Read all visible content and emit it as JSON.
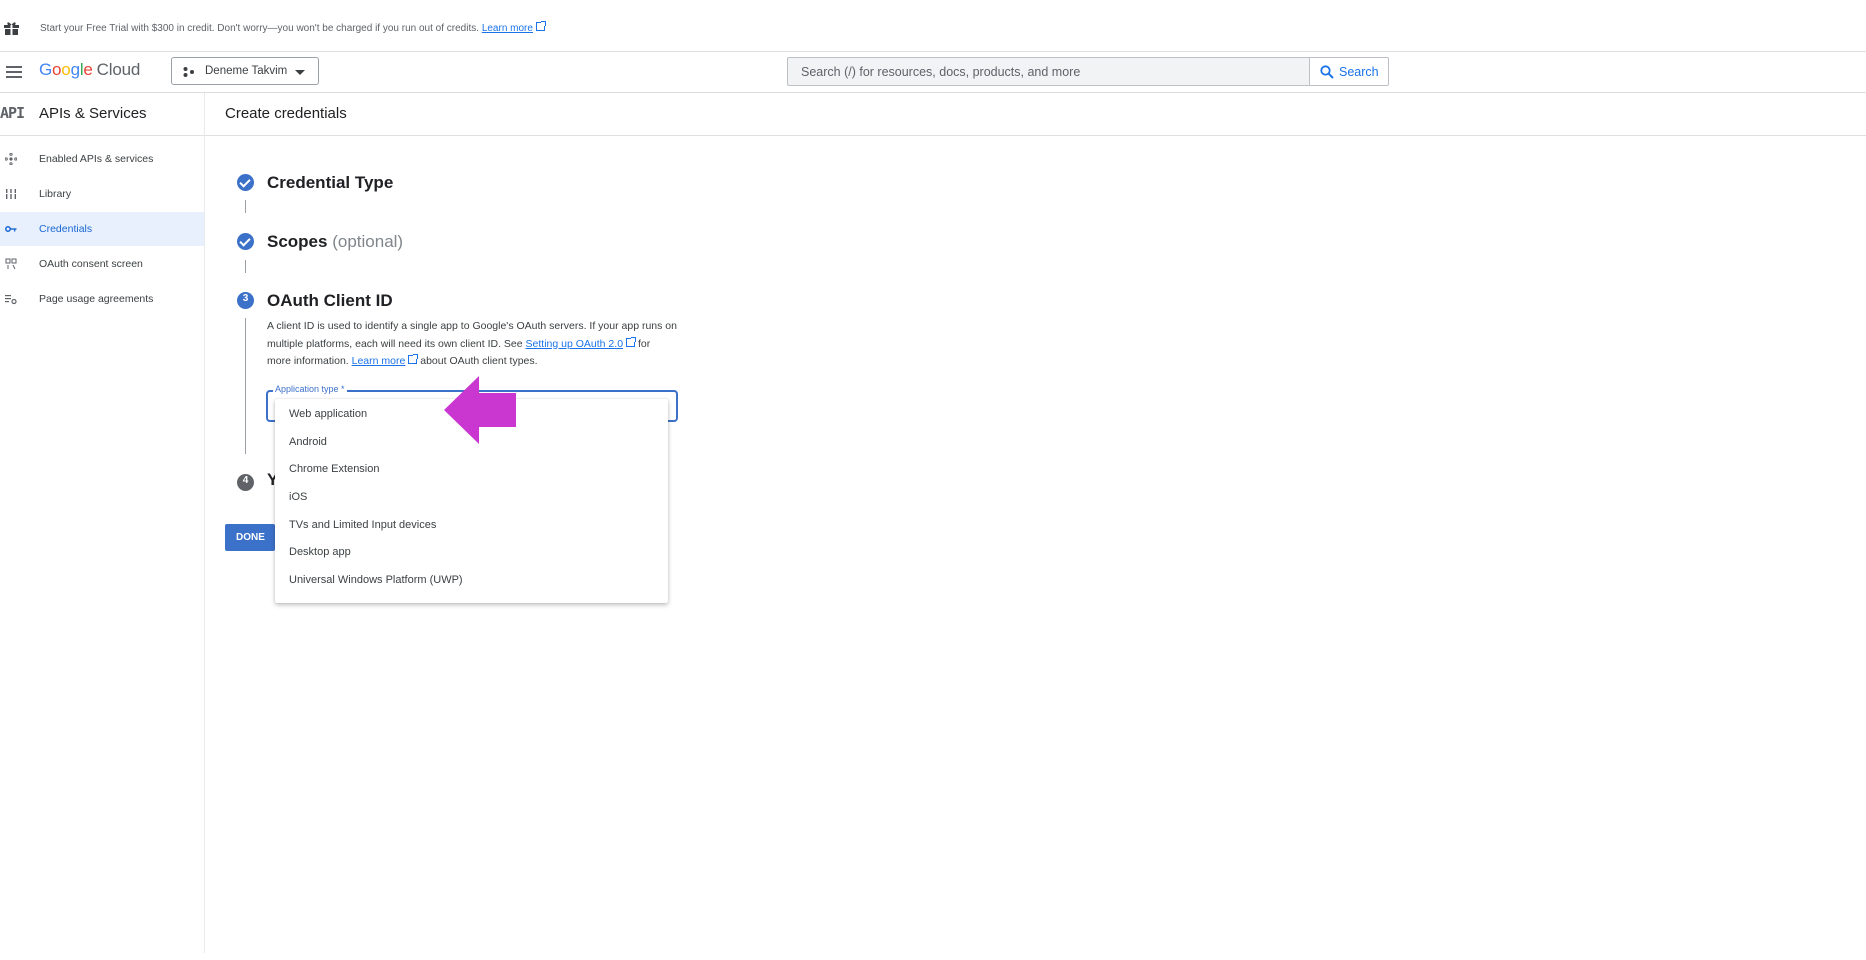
{
  "banner": {
    "text": "Start your Free Trial with $300 in credit. Don't worry—you won't be charged if you run out of credits.",
    "link": "Learn more"
  },
  "topbar": {
    "logo_letters": [
      "G",
      "o",
      "o",
      "g",
      "l",
      "e"
    ],
    "logo_product": "Cloud",
    "project_name": "Deneme Takvim",
    "search_placeholder": "Search (/) for resources, docs, products, and more",
    "search_button": "Search"
  },
  "sidebar": {
    "api_badge": "API",
    "title": "APIs & Services",
    "items": [
      {
        "label": "Enabled APIs & services",
        "icon": "hub-icon"
      },
      {
        "label": "Library",
        "icon": "library-icon"
      },
      {
        "label": "Credentials",
        "icon": "key-icon",
        "active": true
      },
      {
        "label": "OAuth consent screen",
        "icon": "consent-icon"
      },
      {
        "label": "Page usage agreements",
        "icon": "settings-list-icon"
      }
    ]
  },
  "main": {
    "title": "Create credentials",
    "steps": [
      {
        "title": "Credential Type",
        "state": "done"
      },
      {
        "title": "Scopes",
        "optional": "(optional)",
        "state": "done"
      },
      {
        "number": "3",
        "title": "OAuth Client ID",
        "state": "active"
      },
      {
        "number": "4",
        "title": "Y",
        "state": "pending"
      }
    ],
    "description": {
      "part1": "A client ID is used to identify a single app to Google's OAuth servers. If your app runs on multiple platforms, each will need its own client ID. See ",
      "link1": "Setting up OAuth 2.0",
      "part2": " for more information. ",
      "link2": "Learn more",
      "part3": " about OAuth client types."
    },
    "field_label": "Application type *",
    "dropdown_options": [
      "Web application",
      "Android",
      "Chrome Extension",
      "iOS",
      "TVs and Limited Input devices",
      "Desktop app",
      "Universal Windows Platform (UWP)"
    ],
    "done_button": "DONE"
  },
  "colors": {
    "accent": "#3c71c9",
    "link": "#1a73e8",
    "annotation_arrow": "#c936d0"
  }
}
